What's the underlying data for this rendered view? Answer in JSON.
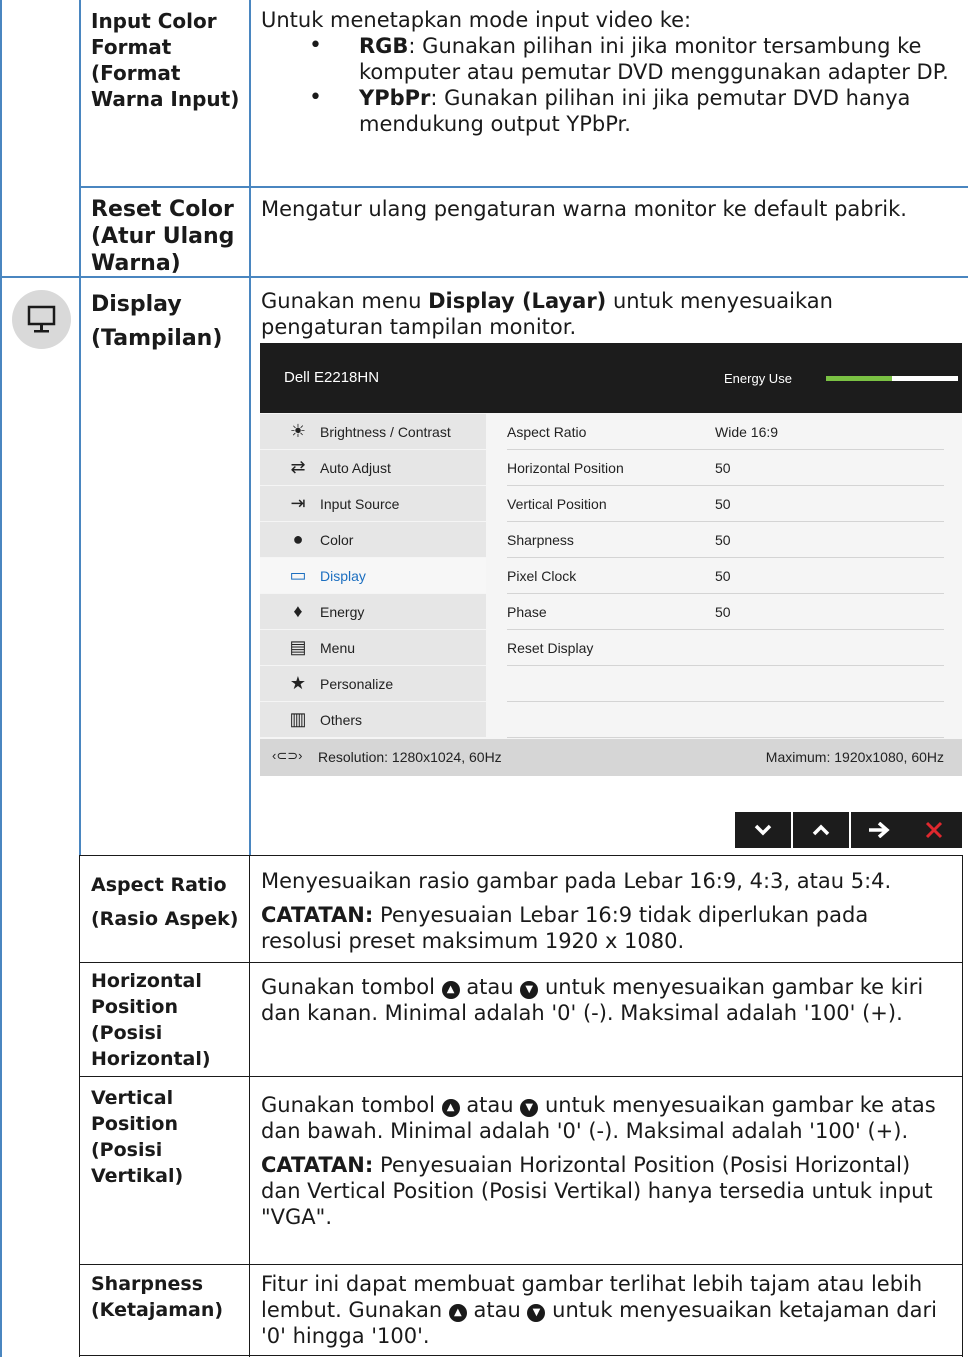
{
  "rows": {
    "input_color_format": {
      "label": "Input Color Format (Format Warna Input)",
      "intro": "Untuk menetapkan mode input video ke:",
      "options": [
        {
          "name": "RGB",
          "text": ": Gunakan pilihan ini jika monitor tersambung ke komputer atau pemutar DVD menggunakan adapter DP."
        },
        {
          "name": "YPbPr",
          "text": ": Gunakan pilihan ini jika pemutar DVD hanya mendukung output YPbPr."
        }
      ]
    },
    "reset_color": {
      "label": "Reset Color (Atur Ulang Warna)",
      "text": "Mengatur ulang pengaturan warna monitor ke default pabrik."
    },
    "display": {
      "label_line1": "Display",
      "label_line2": "(Tampilan)",
      "text_pre": "Gunakan menu ",
      "text_bold": "Display (Layar)",
      "text_post": " untuk menyesuaikan pengaturan tampilan monitor."
    },
    "aspect_ratio": {
      "label_line1": "Aspect Ratio",
      "label_line2": "(Rasio Aspek)",
      "text": "Menyesuaikan rasio gambar pada Lebar 16:9, 4:3, atau 5:4.",
      "note_bold": "CATATAN:",
      "note": " Penyesuaian Lebar 16:9 tidak diperlukan pada resolusi preset maksimum 1920 x 1080."
    },
    "horizontal_position": {
      "label": "Horizontal Position (Posisi Horizontal)",
      "text_pre": "Gunakan tombol ",
      "text_mid": " atau ",
      "text_post": " untuk menyesuaikan gambar ke kiri dan kanan. Minimal adalah '0' (-). Maksimal adalah '100' (+)."
    },
    "vertical_position": {
      "label": "Vertical Position (Posisi Vertikal)",
      "text_pre": "Gunakan tombol ",
      "text_mid": " atau ",
      "text_post": " untuk menyesuaikan gambar ke atas dan bawah. Minimal adalah '0' (-). Maksimal adalah '100' (+).",
      "note_bold": "CATATAN:",
      "note": " Penyesuaian Horizontal Position (Posisi Horizontal) dan Vertical Position (Posisi Vertikal) hanya tersedia untuk input \"VGA\"."
    },
    "sharpness": {
      "label": "Sharpness (Ketajaman)",
      "text_pre": "Fitur ini dapat membuat gambar terlihat lebih tajam atau lebih lembut. Gunakan ",
      "text_mid": " atau ",
      "text_post": " untuk menyesuaikan ketajaman dari '0' hingga '100'."
    }
  },
  "osd": {
    "model": "Dell E2218HN",
    "energy_label": "Energy Use",
    "energy_level": 0.5,
    "menu": [
      {
        "icon": "brightness-icon",
        "glyph": "☀",
        "label": "Brightness / Contrast"
      },
      {
        "icon": "auto-adjust-icon",
        "glyph": "⇄",
        "label": "Auto Adjust"
      },
      {
        "icon": "input-source-icon",
        "glyph": "⇥",
        "label": "Input Source"
      },
      {
        "icon": "color-icon",
        "glyph": "●",
        "label": "Color"
      },
      {
        "icon": "display-icon",
        "glyph": "▭",
        "label": "Display",
        "selected": true
      },
      {
        "icon": "energy-icon",
        "glyph": "♦",
        "label": "Energy"
      },
      {
        "icon": "menu-icon",
        "glyph": "▤",
        "label": "Menu"
      },
      {
        "icon": "personalize-icon",
        "glyph": "★",
        "label": "Personalize"
      },
      {
        "icon": "others-icon",
        "glyph": "▥",
        "label": "Others"
      }
    ],
    "settings": [
      {
        "name": "Aspect Ratio",
        "value": "Wide 16:9"
      },
      {
        "name": "Horizontal Position",
        "value": "50"
      },
      {
        "name": "Vertical Position",
        "value": "50"
      },
      {
        "name": "Sharpness",
        "value": "50"
      },
      {
        "name": "Pixel Clock",
        "value": "50"
      },
      {
        "name": "Phase",
        "value": "50"
      },
      {
        "name": "Reset Display",
        "value": ""
      }
    ],
    "resolution": "Resolution: 1280x1024, 60Hz",
    "maximum": "Maximum: 1920x1080, 60Hz",
    "accent_color": "#1c6fc0",
    "energy_color": "#7ac143"
  },
  "nav_buttons": [
    {
      "icon": "chevron-down-icon",
      "glyph": "⌄"
    },
    {
      "icon": "chevron-up-icon",
      "glyph": "⌃"
    },
    {
      "icon": "arrow-right-icon",
      "glyph": "→"
    },
    {
      "icon": "close-icon",
      "glyph": "✕"
    }
  ]
}
